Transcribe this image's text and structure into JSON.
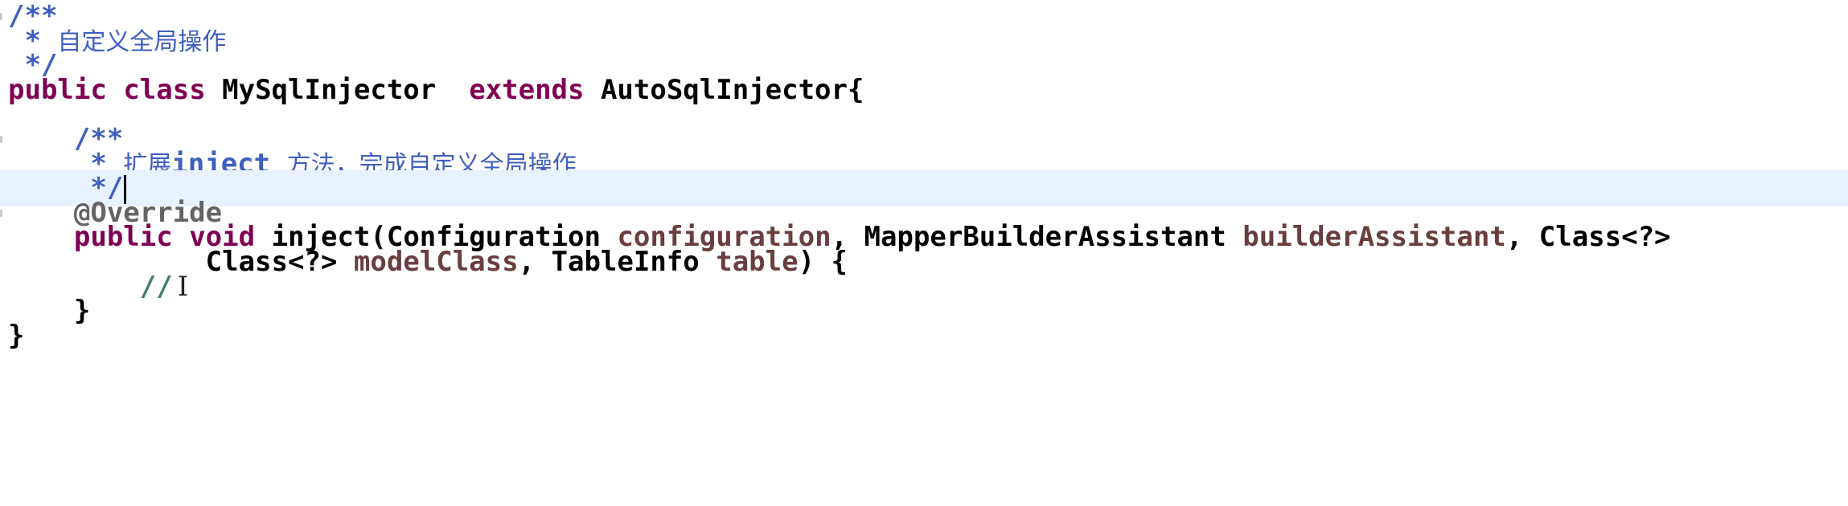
{
  "editor": {
    "lines": [
      [
        {
          "t": "/**",
          "c": "jd"
        }
      ],
      [
        {
          "t": " * ",
          "c": "jd"
        },
        {
          "t": "自定义全局操作",
          "c": "jd cjk"
        }
      ],
      [
        {
          "t": " */",
          "c": "jd"
        }
      ],
      [
        {
          "t": "public",
          "c": "kw"
        },
        {
          "t": " ",
          "c": "plain"
        },
        {
          "t": "class",
          "c": "kw"
        },
        {
          "t": " MySqlInjector  ",
          "c": "plain"
        },
        {
          "t": "extends",
          "c": "kw"
        },
        {
          "t": " AutoSqlInjector{",
          "c": "plain"
        }
      ],
      [],
      [
        {
          "t": "    /**",
          "c": "jd"
        }
      ],
      [
        {
          "t": "     * ",
          "c": "jd"
        },
        {
          "t": "扩展",
          "c": "jd cjk"
        },
        {
          "t": "inject",
          "c": "jd-tag"
        },
        {
          "t": " ",
          "c": "jd"
        },
        {
          "t": "方法，完成自定义全局操作",
          "c": "jd cjk"
        }
      ],
      [
        {
          "t": "     */",
          "c": "jd"
        }
      ],
      [
        {
          "t": "    @Override",
          "c": "ann"
        }
      ],
      [
        {
          "t": "    ",
          "c": "plain"
        },
        {
          "t": "public",
          "c": "kw"
        },
        {
          "t": " ",
          "c": "plain"
        },
        {
          "t": "void",
          "c": "kw"
        },
        {
          "t": " inject(Configuration ",
          "c": "plain"
        },
        {
          "t": "configuration",
          "c": "field"
        },
        {
          "t": ", MapperBuilderAssistant ",
          "c": "plain"
        },
        {
          "t": "builderAssistant",
          "c": "field"
        },
        {
          "t": ", Class<?>",
          "c": "plain"
        }
      ],
      [
        {
          "t": "            Class<?> ",
          "c": "plain"
        },
        {
          "t": "modelClass",
          "c": "field"
        },
        {
          "t": ", TableInfo ",
          "c": "plain"
        },
        {
          "t": "table",
          "c": "field"
        },
        {
          "t": ") {",
          "c": "plain"
        }
      ],
      [
        {
          "t": "        //",
          "c": "cmt"
        }
      ],
      [
        {
          "t": "    }",
          "c": "plain"
        }
      ],
      [
        {
          "t": "}",
          "c": "plain"
        }
      ]
    ],
    "current_line": 7,
    "cursor_icon": "text-cursor-icon",
    "gutter_marks": [
      0,
      5,
      8
    ]
  }
}
